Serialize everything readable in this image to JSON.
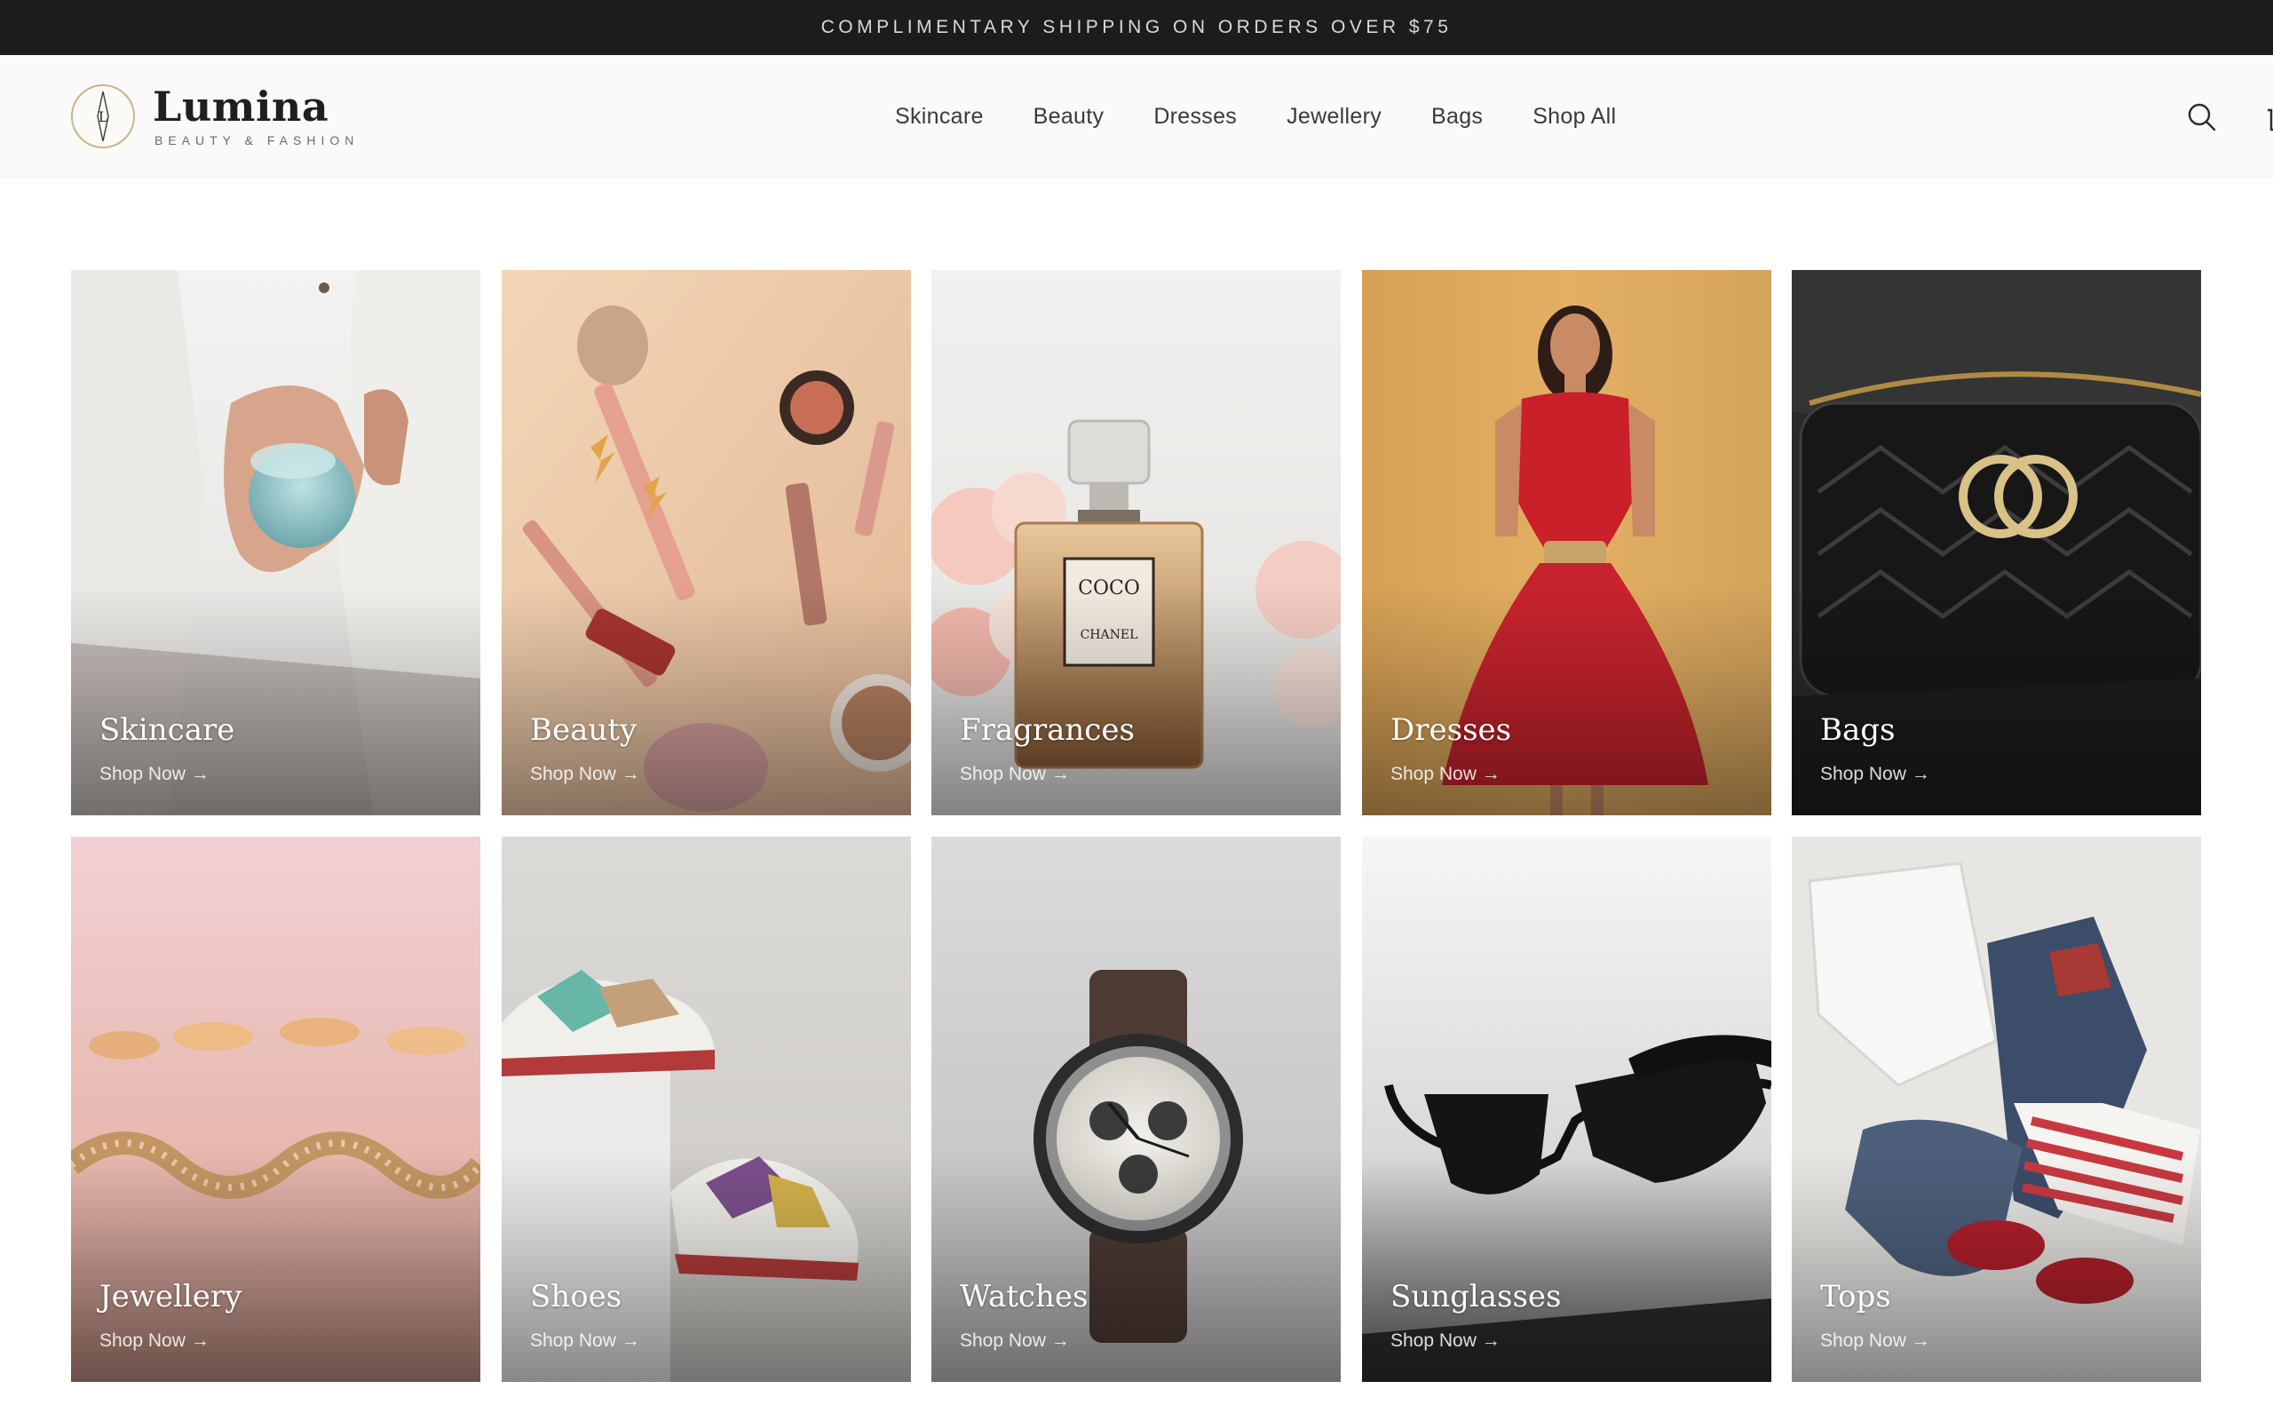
{
  "announcement": {
    "text": "COMPLIMENTARY SHIPPING ON ORDERS OVER $75"
  },
  "header": {
    "brand": "Lumina",
    "tagline": "BEAUTY & FASHION",
    "logo_letter": "L",
    "nav": [
      "Skincare",
      "Beauty",
      "Dresses",
      "Jewellery",
      "Bags",
      "Shop All"
    ],
    "search_icon": "search-icon",
    "cart_icon": "cart-icon"
  },
  "categories": [
    {
      "title": "Skincare",
      "cta": "Shop Now →",
      "image": "hands holding skincare jar"
    },
    {
      "title": "Beauty",
      "cta": "Shop Now →",
      "image": "makeup brushes and lipstick flat lay"
    },
    {
      "title": "Fragrances",
      "cta": "Shop Now →",
      "image": "perfume bottle with roses"
    },
    {
      "title": "Dresses",
      "cta": "Shop Now →",
      "image": "woman in red floral dress"
    },
    {
      "title": "Bags",
      "cta": "Shop Now →",
      "image": "black quilted leather bag"
    },
    {
      "title": "Jewellery",
      "cta": "Shop Now →",
      "image": "gold jewelled bracelet"
    },
    {
      "title": "Shoes",
      "cta": "Shop Now →",
      "image": "colourful sneakers"
    },
    {
      "title": "Watches",
      "cta": "Shop Now →",
      "image": "chronograph watch"
    },
    {
      "title": "Sunglasses",
      "cta": "Shop Now →",
      "image": "black sunglasses"
    },
    {
      "title": "Tops",
      "cta": "Shop Now →",
      "image": "folded tops and jeans"
    }
  ],
  "colors": {
    "announcement_bg": "#1c1c1c",
    "header_bg": "#fafaf8",
    "logo_accent": "#cbb58a"
  }
}
